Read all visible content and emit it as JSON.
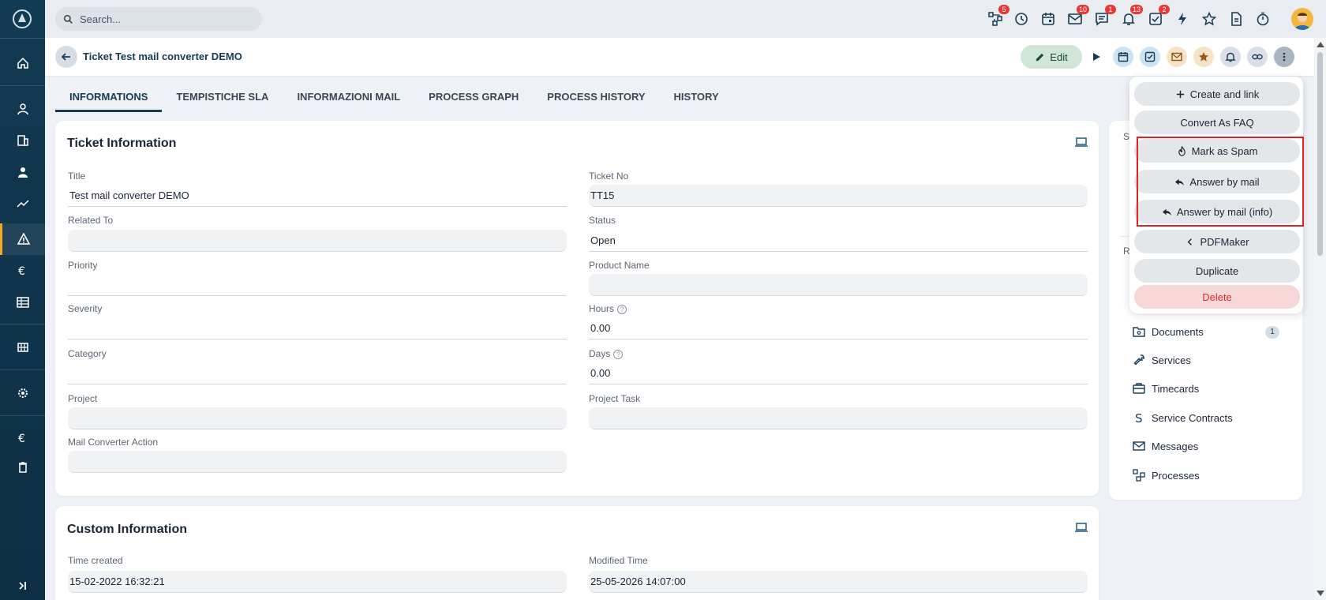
{
  "search": {
    "placeholder": "Search..."
  },
  "topbar": {
    "badges": {
      "processes": "5",
      "mail": "10",
      "comments": "1",
      "notifications": "13",
      "tasks": "2"
    }
  },
  "record": {
    "title": "Ticket Test mail converter DEMO",
    "edit_label": "Edit"
  },
  "tabs": [
    "INFORMATIONS",
    "TEMPISTICHE SLA",
    "INFORMAZIONI MAIL",
    "PROCESS GRAPH",
    "PROCESS HISTORY",
    "HISTORY"
  ],
  "ticket_info": {
    "heading": "Ticket Information",
    "fields": {
      "title": {
        "label": "Title",
        "value": "Test mail converter DEMO"
      },
      "ticket_no": {
        "label": "Ticket No",
        "value": "TT15"
      },
      "related_to": {
        "label": "Related To",
        "value": ""
      },
      "status": {
        "label": "Status",
        "value": "Open"
      },
      "priority": {
        "label": "Priority",
        "value": ""
      },
      "product_name": {
        "label": "Product Name",
        "value": ""
      },
      "severity": {
        "label": "Severity",
        "value": ""
      },
      "hours": {
        "label": "Hours",
        "value": "0.00"
      },
      "category": {
        "label": "Category",
        "value": ""
      },
      "days": {
        "label": "Days",
        "value": "0.00"
      },
      "project": {
        "label": "Project",
        "value": ""
      },
      "project_task": {
        "label": "Project Task",
        "value": ""
      },
      "mail_converter_action": {
        "label": "Mail Converter Action",
        "value": ""
      }
    }
  },
  "custom_info": {
    "heading": "Custom Information",
    "fields": {
      "time_created": {
        "label": "Time created",
        "value": "15-02-2022 16:32:21"
      },
      "modified_time": {
        "label": "Modified Time",
        "value": "25-05-2026 14:07:00"
      }
    }
  },
  "right_panel": {
    "partial_label_top": "S",
    "partial_label_mid": "R",
    "related": [
      {
        "label": "Documents",
        "count": "1",
        "icon": "folder-icon"
      },
      {
        "label": "Services",
        "count": "",
        "icon": "wrench-icon"
      },
      {
        "label": "Timecards",
        "count": "",
        "icon": "briefcase-icon"
      },
      {
        "label": "Service Contracts",
        "count": "",
        "icon": "s-letter-icon"
      },
      {
        "label": "Messages",
        "count": "",
        "icon": "envelope-icon"
      },
      {
        "label": "Processes",
        "count": "",
        "icon": "process-icon"
      }
    ]
  },
  "menu": {
    "create_and_link": "Create and link",
    "convert_faq": "Convert As FAQ",
    "mark_spam": "Mark as Spam",
    "answer_mail": "Answer by mail",
    "answer_mail_info": "Answer by mail (info)",
    "pdfmaker": "PDFMaker",
    "duplicate": "Duplicate",
    "delete": "Delete"
  },
  "colors": {
    "sidebar": "#123a52",
    "accent": "#163b53",
    "active_marker": "#f5a623",
    "badge": "#e53935",
    "highlight_box": "#e02020",
    "delete": "#d32f2f"
  }
}
